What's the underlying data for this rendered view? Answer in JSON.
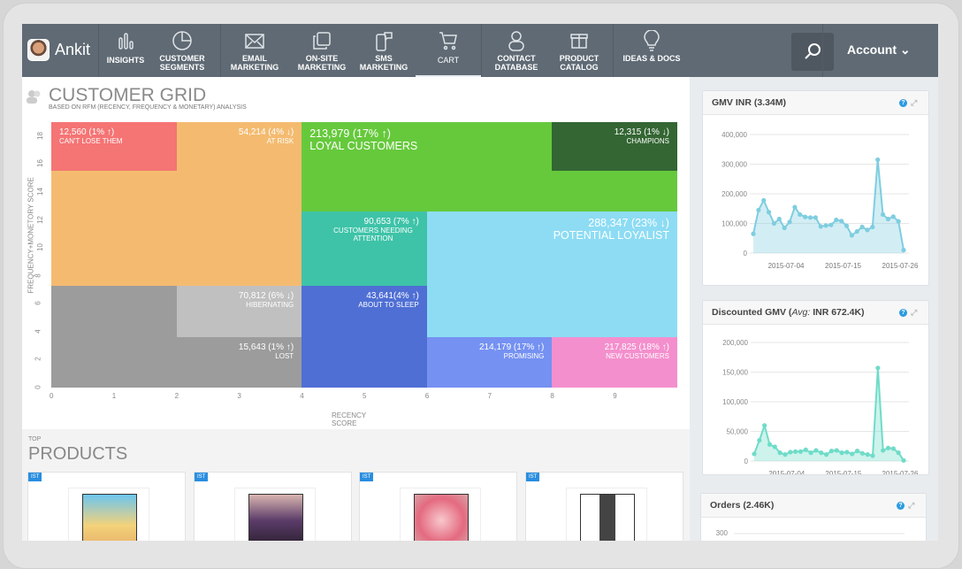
{
  "nav": {
    "user": "Ankit",
    "items": [
      {
        "label": "INSIGHTS",
        "icon": "bar-chart-icon"
      },
      {
        "label": "CUSTOMER SEGMENTS",
        "icon": "pie-chart-icon"
      },
      {
        "label": "EMAIL MARKETING",
        "icon": "envelope-icon"
      },
      {
        "label": "ON-SITE MARKETING",
        "icon": "windows-icon"
      },
      {
        "label": "SMS MARKETING",
        "icon": "phone-chat-icon"
      },
      {
        "label": "CART",
        "icon": "cart-icon"
      },
      {
        "label": "CONTACT DATABASE",
        "icon": "person-icon"
      },
      {
        "label": "PRODUCT CATALOG",
        "icon": "box-icon"
      },
      {
        "label": "IDEAS & DOCS",
        "icon": "lightbulb-icon"
      }
    ],
    "active": "CART",
    "account": "Account"
  },
  "grid": {
    "title": "CUSTOMER GRID",
    "subtitle": "BASED ON RFM (RECENCY, FREQUENCY & MONETARY) ANALYSIS"
  },
  "products": {
    "top": "TOP",
    "title": "PRODUCTS",
    "items": [
      {
        "badge": "IST"
      },
      {
        "badge": "IST"
      },
      {
        "badge": "IST"
      },
      {
        "badge": "IST"
      }
    ]
  },
  "chart_data": [
    {
      "type": "heatmap",
      "title": "CUSTOMER GRID",
      "xlabel": "RECENCY SCORE",
      "ylabel": "FREQUENCY+MONETORY SCORE",
      "xlim": [
        0,
        10
      ],
      "ylim": [
        0,
        19
      ],
      "xticks": [
        "0",
        "1",
        "2",
        "3",
        "4",
        "5",
        "6",
        "7",
        "8",
        "9"
      ],
      "yticks": [
        "0",
        "2",
        "4",
        "6",
        "8",
        "10",
        "12",
        "14",
        "16",
        "18"
      ],
      "segments": [
        {
          "value": "54,214 (4% ↓)",
          "label": "AT RISK",
          "x": [
            0,
            4
          ],
          "y": [
            7.3,
            19
          ],
          "color": "#f4bb70",
          "align": "r"
        },
        {
          "value": "12,560 (1% ↑)",
          "label": "CAN'T LOSE THEM",
          "x": [
            0,
            2
          ],
          "y": [
            15.5,
            19
          ],
          "color": "#f57474",
          "align": "l"
        },
        {
          "value": "213,979 (17% ↑)",
          "label": "LOYAL CUSTOMERS",
          "x": [
            4,
            10
          ],
          "y": [
            12.6,
            19
          ],
          "color": "#66c93c",
          "align": "l",
          "big": true
        },
        {
          "value": "12,315 (1% ↓)",
          "label": "CHAMPIONS",
          "x": [
            8,
            10
          ],
          "y": [
            15.5,
            19
          ],
          "color": "#336633",
          "align": "r"
        },
        {
          "value": "90,653 (7% ↑)",
          "label": "CUSTOMERS NEEDING ATTENTION",
          "x": [
            4,
            6
          ],
          "y": [
            7.3,
            12.6
          ],
          "color": "#3ec3a8",
          "align": "r"
        },
        {
          "value": "288,347 (23% ↓)",
          "label": "POTENTIAL LOYALIST",
          "x": [
            6,
            10
          ],
          "y": [
            3.6,
            12.6
          ],
          "color": "#8ddcf4",
          "align": "r",
          "big": true
        },
        {
          "value": "70,812 (6% ↓)",
          "label": "HIBERNATING",
          "x": [
            2,
            4
          ],
          "y": [
            3.6,
            7.3
          ],
          "color": "#c0c0c0",
          "align": "r"
        },
        {
          "value": "",
          "label": "",
          "x": [
            0,
            2
          ],
          "y": [
            3.6,
            7.3
          ],
          "color": "#9c9c9c",
          "align": "r"
        },
        {
          "value": "15,643 (1% ↑)",
          "label": "LOST",
          "x": [
            0,
            4
          ],
          "y": [
            0,
            3.6
          ],
          "color": "#9c9c9c",
          "align": "r"
        },
        {
          "value": "43,641(4% ↑)",
          "label": "ABOUT TO SLEEP",
          "x": [
            4,
            6
          ],
          "y": [
            0,
            7.3
          ],
          "color": "#4f6fd4",
          "align": "r"
        },
        {
          "value": "214,179 (17% ↑)",
          "label": "PROMISING",
          "x": [
            6,
            8
          ],
          "y": [
            0,
            3.6
          ],
          "color": "#7591f2",
          "align": "r"
        },
        {
          "value": "217,825 (18% ↑)",
          "label": "NEW CUSTOMERS",
          "x": [
            8,
            10
          ],
          "y": [
            0,
            3.6
          ],
          "color": "#f48fcd",
          "align": "r"
        }
      ]
    },
    {
      "type": "area",
      "title": "GMV INR (3.34M)",
      "ylim": [
        0,
        400000
      ],
      "yticks": [
        "0",
        "100,000",
        "200,000",
        "300,000",
        "400,000"
      ],
      "xticks": [
        "2015-07-04",
        "2015-07-15",
        "2015-07-26"
      ],
      "color": "#7fcde0",
      "x_start": "2015-06-27",
      "values": [
        65000,
        145000,
        178000,
        138000,
        100000,
        115000,
        85000,
        105000,
        155000,
        130000,
        122000,
        120000,
        120000,
        90000,
        93000,
        95000,
        112000,
        108000,
        92000,
        60000,
        73000,
        88000,
        78000,
        88000,
        315000,
        130000,
        115000,
        123000,
        107000,
        10000
      ]
    },
    {
      "type": "area",
      "title": "Discounted GMV",
      "title_note": "Avg:",
      "title_value": "INR 672.4K",
      "ylim": [
        0,
        200000
      ],
      "yticks": [
        "0",
        "50,000",
        "100,000",
        "150,000",
        "200,000"
      ],
      "xticks": [
        "2015-07-04",
        "2015-07-15",
        "2015-07-26"
      ],
      "color": "#6fdcc8",
      "x_start": "2015-06-27",
      "values": [
        12000,
        35000,
        60000,
        28000,
        24000,
        14000,
        11000,
        15000,
        16000,
        16000,
        19000,
        14000,
        18000,
        14000,
        11000,
        17000,
        18000,
        14000,
        15000,
        12000,
        17000,
        13000,
        11000,
        9000,
        157000,
        18000,
        22000,
        21000,
        14000,
        1000
      ]
    },
    {
      "type": "line",
      "title": "Orders (2.46K)",
      "yticks": [
        "300"
      ]
    }
  ]
}
